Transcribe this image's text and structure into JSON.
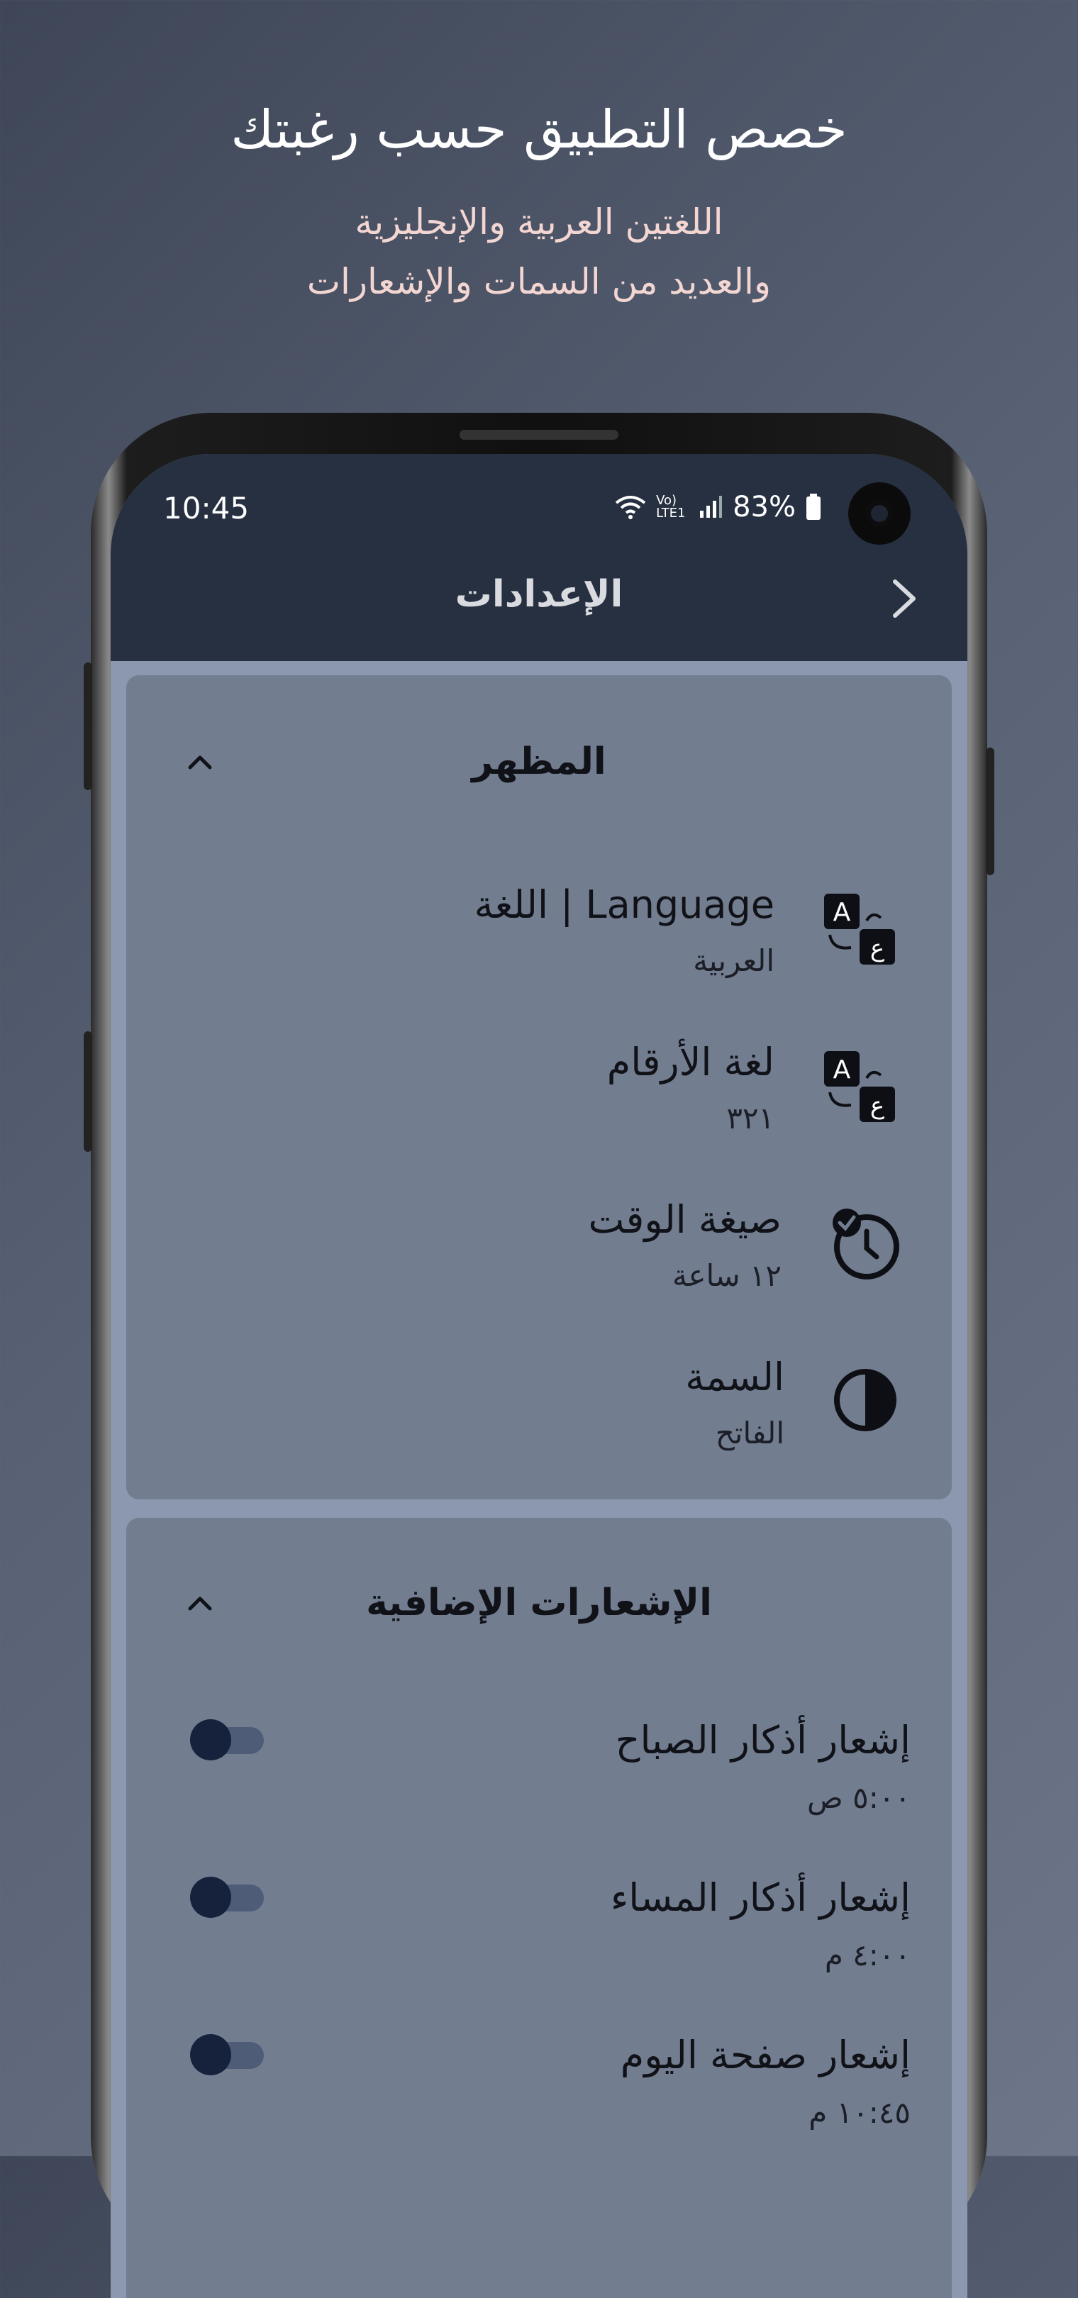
{
  "promo": {
    "headline": "خصص التطبيق حسب رغبتك",
    "sub_line1": "اللغتين العربية والإنجليزية",
    "sub_line2": "والعديد من السمات والإشعارات"
  },
  "status_bar": {
    "time": "10:45",
    "network": "Vo) LTE1",
    "battery": "83%"
  },
  "app_bar": {
    "title": "الإعدادات"
  },
  "appearance": {
    "title": "المظهر",
    "items": [
      {
        "title": "Language | اللغة",
        "value": "العربية",
        "icon": "translate-icon"
      },
      {
        "title": "لغة الأرقام",
        "value": "٣٢١",
        "icon": "translate-icon"
      },
      {
        "title": "صيغة الوقت",
        "value": "١٢ ساعة",
        "icon": "clock-check-icon"
      },
      {
        "title": "السمة",
        "value": "الفاتح",
        "icon": "contrast-icon"
      }
    ]
  },
  "notifications": {
    "title": "الإشعارات الإضافية",
    "items": [
      {
        "title": "إشعار أذكار الصباح",
        "time": "٥:٠٠ ص",
        "enabled": false
      },
      {
        "title": "إشعار أذكار المساء",
        "time": "٤:٠٠ م",
        "enabled": false
      },
      {
        "title": "إشعار صفحة اليوم",
        "time": "١٠:٤٥ م",
        "enabled": false
      }
    ]
  },
  "colors": {
    "background": "#586174",
    "app_bar": "#273041",
    "card": "#727d90",
    "accent_text": "#f3d6d2",
    "toggle_knob": "#16223c"
  }
}
